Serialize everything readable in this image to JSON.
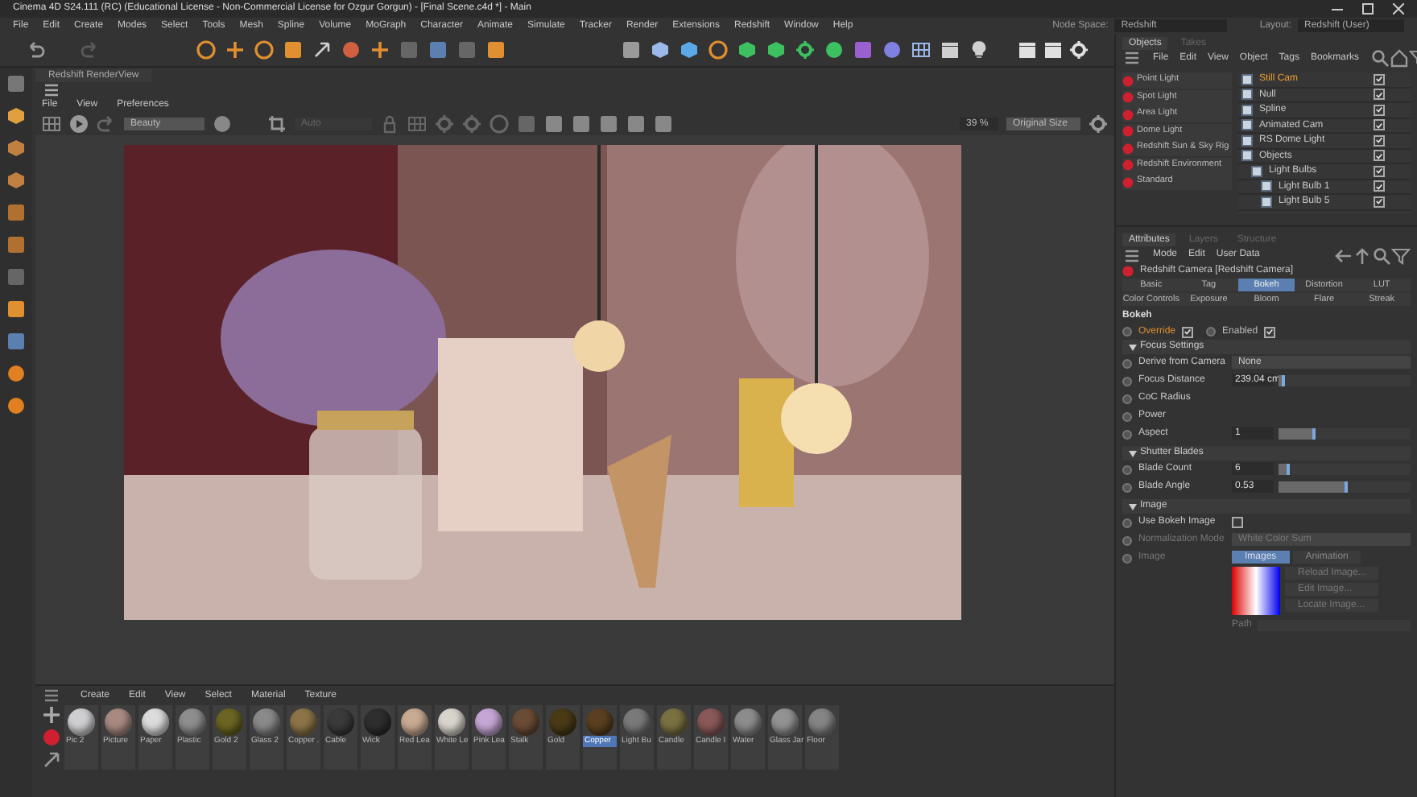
{
  "window": {
    "title": "Cinema 4D S24.111 (RC) (Educational License - Non-Commercial License for Ozgur Gorgun) - [Final Scene.c4d *] - Main"
  },
  "menu": [
    "File",
    "Edit",
    "Create",
    "Modes",
    "Select",
    "Tools",
    "Mesh",
    "Spline",
    "Volume",
    "MoGraph",
    "Character",
    "Animate",
    "Simulate",
    "Tracker",
    "Render",
    "Extensions",
    "Redshift",
    "Window",
    "Help"
  ],
  "node_space": {
    "label": "Node Space:",
    "value": "Redshift"
  },
  "layout": {
    "label": "Layout:",
    "value": "Redshift (User)"
  },
  "render_view": {
    "title": "Redshift RenderView",
    "menu": [
      "File",
      "View",
      "Preferences"
    ],
    "aov": "Beauty",
    "auto": "Auto",
    "zoom": "39 %",
    "size": "Original Size"
  },
  "objects_panel": {
    "tabs": [
      {
        "label": "Objects",
        "selected": true
      },
      {
        "label": "Takes",
        "selected": false
      }
    ],
    "menu": [
      "File",
      "Edit",
      "View",
      "Object",
      "Tags",
      "Bookmarks"
    ],
    "light_presets": [
      "Point Light",
      "Spot Light",
      "Area Light",
      "Dome Light",
      "Redshift Sun & Sky Rig",
      "Redshift Environment",
      "Standard"
    ],
    "tree": [
      {
        "name": "Still Cam",
        "selected": true,
        "enabled": true
      },
      {
        "name": "Null",
        "selected": false,
        "enabled": true
      },
      {
        "name": "Spline",
        "selected": false,
        "enabled": true
      },
      {
        "name": "Animated Cam",
        "selected": false,
        "enabled": true
      },
      {
        "name": "RS Dome Light",
        "selected": false,
        "enabled": true
      },
      {
        "name": "Objects",
        "selected": false,
        "enabled": true,
        "children": [
          {
            "name": "Light Bulbs",
            "selected": false,
            "enabled": true,
            "children": [
              {
                "name": "Light Bulb 1",
                "selected": false,
                "enabled": true
              },
              {
                "name": "Light Bulb 5",
                "selected": false,
                "enabled": true
              }
            ]
          }
        ]
      }
    ]
  },
  "attributes": {
    "tabs": [
      {
        "label": "Attributes",
        "selected": true
      },
      {
        "label": "Layers",
        "selected": false
      },
      {
        "label": "Structure",
        "selected": false
      }
    ],
    "menu": [
      "Mode",
      "Edit",
      "User Data"
    ],
    "object": "Redshift Camera [Redshift Camera]",
    "sub_tabs": [
      {
        "label": "Basic",
        "selected": false
      },
      {
        "label": "Tag",
        "selected": false
      },
      {
        "label": "Bokeh",
        "selected": true
      },
      {
        "label": "Distortion",
        "selected": false
      },
      {
        "label": "LUT",
        "selected": false
      },
      {
        "label": "Color Controls",
        "selected": false
      },
      {
        "label": "Exposure",
        "selected": false
      },
      {
        "label": "Bloom",
        "selected": false
      },
      {
        "label": "Flare",
        "selected": false
      },
      {
        "label": "Streak",
        "selected": false
      }
    ],
    "section": "Bokeh",
    "toggles": [
      {
        "label": "Override",
        "checked": true,
        "overridden": true
      },
      {
        "label": "Enabled",
        "checked": true,
        "overridden": false
      }
    ],
    "groups": [
      {
        "title": "Focus Settings",
        "rows": [
          {
            "kind": "dropdown",
            "label": "Derive from Camera",
            "value": "None",
            "disabled": false
          },
          {
            "kind": "slider",
            "label": "Focus Distance",
            "value": "239.04 cm",
            "level": 0.05,
            "disabled": false
          },
          {
            "kind": "plain",
            "label": "CoC Radius",
            "disabled": false
          },
          {
            "kind": "plain",
            "label": "Power",
            "disabled": false
          },
          {
            "kind": "slider",
            "label": "Aspect",
            "value": "1",
            "level": 0.28,
            "disabled": false
          }
        ]
      },
      {
        "title": "Shutter Blades",
        "rows": [
          {
            "kind": "slider",
            "label": "Blade Count",
            "value": "6",
            "level": 0.08,
            "disabled": false
          },
          {
            "kind": "slider",
            "label": "Blade Angle",
            "value": "0.53",
            "level": 0.53,
            "disabled": false
          }
        ]
      },
      {
        "title": "Image",
        "rows": [
          {
            "kind": "checkbox",
            "label": "Use Bokeh Image",
            "checked": false,
            "disabled": false
          },
          {
            "kind": "dropdown",
            "label": "Normalization Mode",
            "value": "White Color Sum",
            "disabled": true
          },
          {
            "label": "Image",
            "modes": [
              {
                "label": "Images",
                "selected": true
              },
              {
                "label": "Animation",
                "selected": false
              }
            ],
            "buttons": [
              "Reload Image...",
              "Edit Image...",
              "Locate Image..."
            ],
            "path_label": "Path",
            "disabled": true
          }
        ]
      }
    ]
  },
  "material_manager": {
    "menu": [
      "Create",
      "Edit",
      "View",
      "Select",
      "Material",
      "Texture"
    ],
    "materials": [
      {
        "name": "Pic 2",
        "color": "#cfcfd2",
        "selected": false
      },
      {
        "name": "Picture",
        "color": "#a88a80",
        "selected": false
      },
      {
        "name": "Paper",
        "color": "#dcdcdc",
        "selected": false
      },
      {
        "name": "Plastic",
        "color": "#8e8e8e",
        "selected": false
      },
      {
        "name": "Gold 2",
        "color": "#6b6422",
        "selected": false
      },
      {
        "name": "Glass 2",
        "color": "#8a8a8a",
        "selected": false
      },
      {
        "name": "Copper .",
        "color": "#8c7448",
        "selected": false
      },
      {
        "name": "Cable",
        "color": "#3a3a3a",
        "selected": false
      },
      {
        "name": "Wick",
        "color": "#2e2e2e",
        "selected": false
      },
      {
        "name": "Red Lea",
        "color": "#c9aa92",
        "selected": false
      },
      {
        "name": "White Le",
        "color": "#d9d4cc",
        "selected": false
      },
      {
        "name": "Pink Lea",
        "color": "#c6a6d4",
        "selected": false
      },
      {
        "name": "Stalk",
        "color": "#6a4c36",
        "selected": false
      },
      {
        "name": "Gold",
        "color": "#4a3a16",
        "selected": false
      },
      {
        "name": "Copper",
        "color": "#5a4020",
        "selected": true
      },
      {
        "name": "Light Bu",
        "color": "#7a7a7a",
        "selected": false
      },
      {
        "name": "Candle",
        "color": "#7a7040",
        "selected": false
      },
      {
        "name": "Candle I",
        "color": "#8a5858",
        "selected": false
      },
      {
        "name": "Water",
        "color": "#8c8c8c",
        "selected": false
      },
      {
        "name": "Glass Jar",
        "color": "#929292",
        "selected": false
      },
      {
        "name": "Floor",
        "color": "#858585",
        "selected": false
      }
    ]
  }
}
